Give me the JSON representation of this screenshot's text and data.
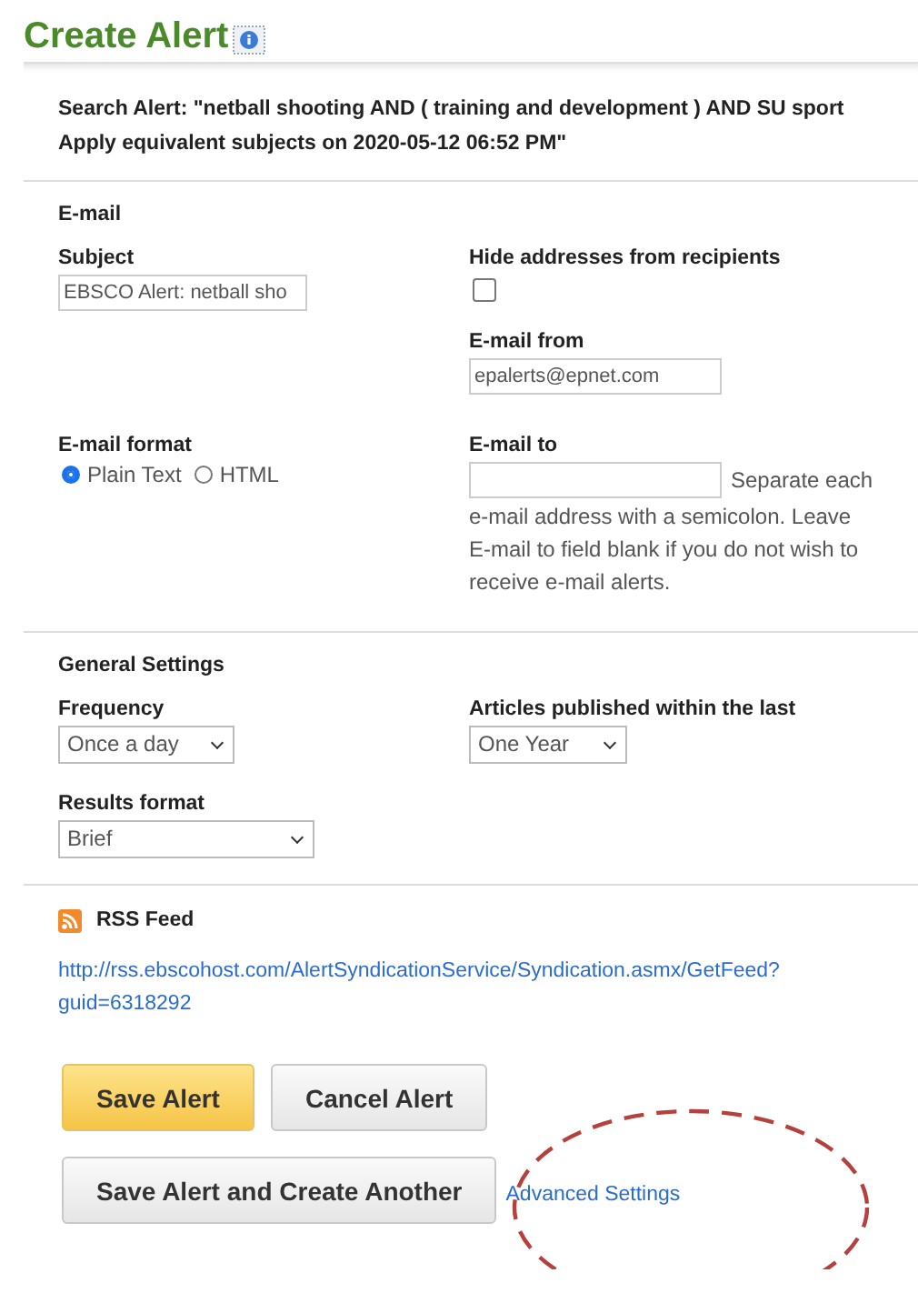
{
  "title": "Create Alert",
  "search_alert": "Search Alert: \"netball shooting AND ( training and development ) AND SU sport Apply equivalent subjects on 2020-05-12 06:52 PM\"",
  "email": {
    "heading": "E-mail",
    "subject": {
      "label": "Subject",
      "value": "EBSCO Alert: netball sho"
    },
    "hide_addresses": {
      "label": "Hide addresses from recipients",
      "checked": false
    },
    "from": {
      "label": "E-mail from",
      "value": "epalerts@epnet.com"
    },
    "format": {
      "label": "E-mail format",
      "options": [
        {
          "label": "Plain Text",
          "selected": true
        },
        {
          "label": "HTML",
          "selected": false
        }
      ]
    },
    "to": {
      "label": "E-mail to",
      "note_first": "Separate each",
      "note_rest": "e-mail address with a semicolon. Leave E-mail to field blank if you do not wish to receive e-mail alerts."
    }
  },
  "general": {
    "heading": "General Settings",
    "frequency": {
      "label": "Frequency",
      "value": "Once a day"
    },
    "published": {
      "label": "Articles published within the last",
      "value": "One Year"
    },
    "results_format": {
      "label": "Results format",
      "value": "Brief"
    }
  },
  "rss": {
    "heading": "RSS Feed",
    "url": "http://rss.ebscohost.com/AlertSyndicationService/Syndication.asmx/GetFeed?guid=6318292"
  },
  "buttons": [
    {
      "label": "Save Alert",
      "kind": "primary"
    },
    {
      "label": "Cancel Alert",
      "kind": "secondary"
    }
  ],
  "save_another": "Save Alert and Create Another",
  "advanced_link": "Advanced Settings"
}
